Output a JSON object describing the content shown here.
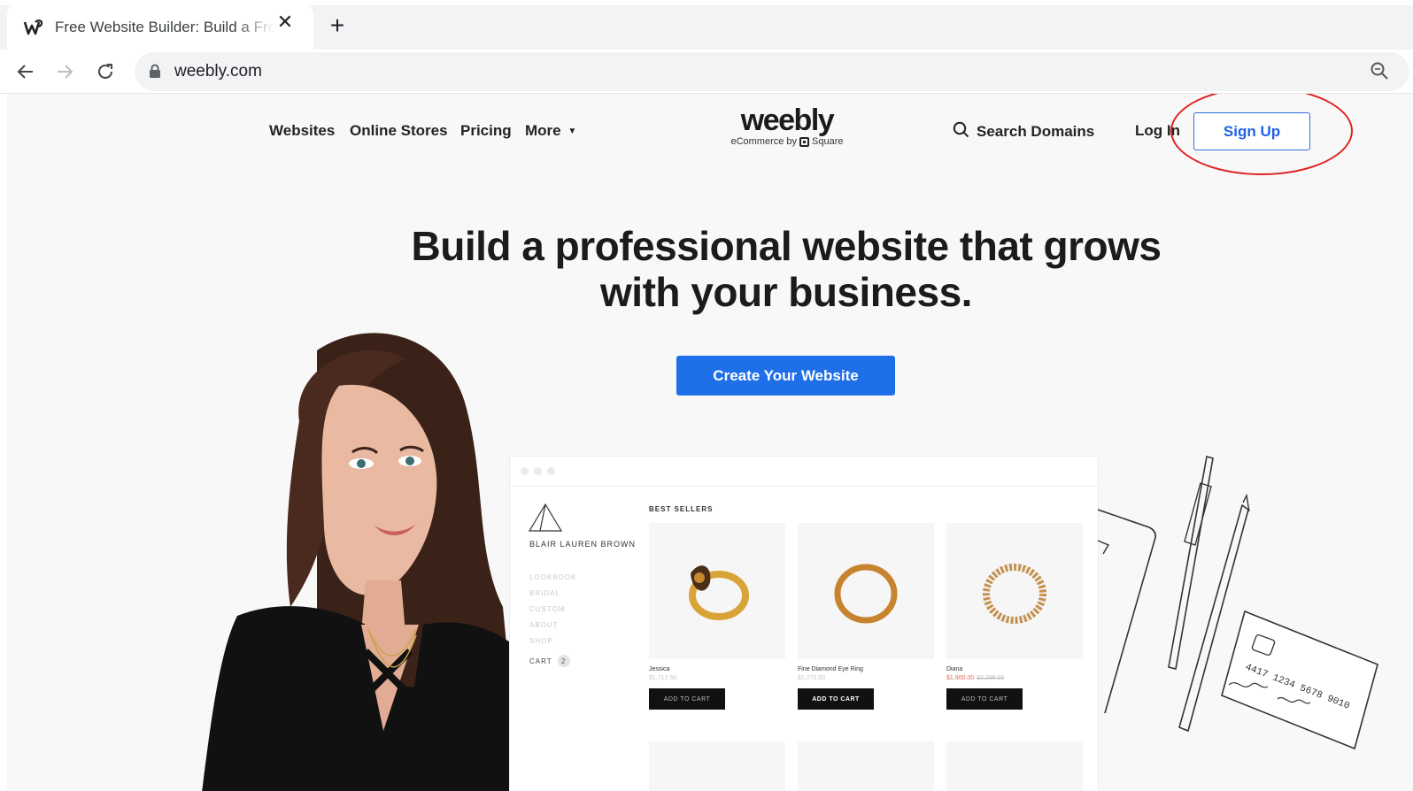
{
  "browser": {
    "tab_title": "Free Website Builder: Build a Free Website or Online Store",
    "url": "weebly.com"
  },
  "site": {
    "nav": {
      "websites": "Websites",
      "online_stores": "Online Stores",
      "pricing": "Pricing",
      "more": "More"
    },
    "logo": {
      "word": "weebly",
      "sub_prefix": "eCommerce by",
      "sub_brand": "Square"
    },
    "search_domains": "Search Domains",
    "login": "Log In",
    "signup": "Sign Up",
    "hero_line1": "Build a professional website that grows",
    "hero_line2": "with your business.",
    "cta": "Create Your Website",
    "accent_color": "#1f6fe8"
  },
  "store_mock": {
    "brand_name": "BLAIR LAUREN BROWN",
    "menu": [
      "LOOKBOOK",
      "BRIDAL",
      "CUSTOM",
      "ABOUT",
      "SHOP"
    ],
    "cart_label": "CART",
    "cart_count": "2",
    "section_title": "BEST SELLERS",
    "products": [
      {
        "name": "Jessica",
        "price": "$1,712.50",
        "button": "ADD TO CART"
      },
      {
        "name": "Fine Diamond Eye Ring",
        "price": "$1,275.00",
        "button": "ADD TO CART"
      },
      {
        "name": "Diana",
        "sale_price": "$1,900.00",
        "old_price": "$2,299.00",
        "button": "ADD TO CART"
      }
    ],
    "card_text": "4417 1234 5678 9010"
  }
}
